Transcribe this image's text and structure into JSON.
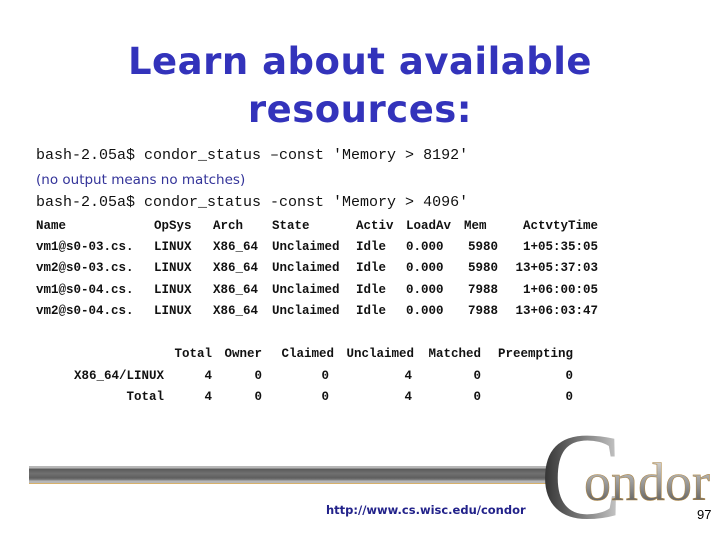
{
  "slide": {
    "title_lines": [
      "Learn about available",
      "resources:"
    ],
    "commands": [
      "bash-2.05a$ condor_status –const 'Memory > 8192'",
      "bash-2.05a$ condor_status -const 'Memory > 4096'"
    ],
    "note": "(no output means no matches)",
    "status_table": {
      "headers": [
        "Name",
        "OpSys",
        "Arch",
        "State",
        "Activ",
        "LoadAv",
        "Mem",
        "ActvtyTime"
      ],
      "rows": [
        [
          "vm1@s0-03.cs.",
          "LINUX",
          "X86_64",
          "Unclaimed",
          "Idle",
          "0.000",
          "5980",
          "1+05:35:05"
        ],
        [
          "vm2@s0-03.cs.",
          "LINUX",
          "X86_64",
          "Unclaimed",
          "Idle",
          "0.000",
          "5980",
          "13+05:37:03"
        ],
        [
          "vm1@s0-04.cs.",
          "LINUX",
          "X86_64",
          "Unclaimed",
          "Idle",
          "0.000",
          "7988",
          "1+06:00:05"
        ],
        [
          "vm2@s0-04.cs.",
          "LINUX",
          "X86_64",
          "Unclaimed",
          "Idle",
          "0.000",
          "7988",
          "13+06:03:47"
        ]
      ]
    },
    "summary_table": {
      "headers": [
        "",
        "Total",
        "Owner",
        "Claimed",
        "Unclaimed",
        "Matched",
        "Preempting"
      ],
      "rows": [
        [
          "X86_64/LINUX",
          "4",
          "0",
          "0",
          "4",
          "0",
          "0"
        ],
        [
          "Total",
          "4",
          "0",
          "0",
          "4",
          "0",
          "0"
        ]
      ]
    },
    "footer": {
      "url": "http://www.cs.wisc.edu/condor",
      "logo_text": "Condor",
      "page_number": "97"
    },
    "colors": {
      "title": "#3333bb",
      "note": "#333399",
      "url": "#22228a",
      "text": "#111111"
    }
  }
}
